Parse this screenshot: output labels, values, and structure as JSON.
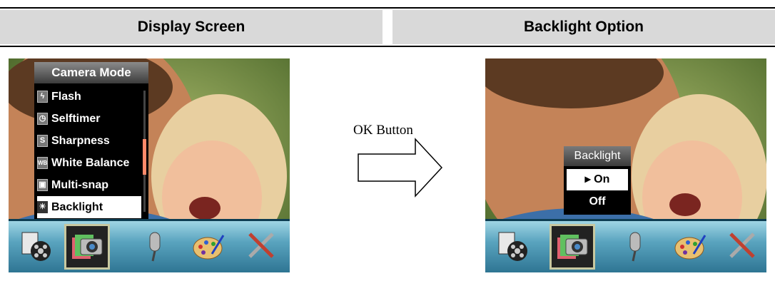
{
  "headers": {
    "left": "Display Screen",
    "right": "Backlight Option"
  },
  "left_screen": {
    "menu_title": "Camera Mode",
    "menu_items": [
      {
        "label": "Flash",
        "icon": "flash-icon",
        "glyph": "ϟ"
      },
      {
        "label": "Selftimer",
        "icon": "selftimer-icon",
        "glyph": "◷"
      },
      {
        "label": "Sharpness",
        "icon": "sharpness-icon",
        "glyph": "S"
      },
      {
        "label": "White Balance",
        "icon": "white-balance-icon",
        "glyph": "WB"
      },
      {
        "label": "Multi-snap",
        "icon": "multi-snap-icon",
        "glyph": "▣"
      },
      {
        "label": "Backlight",
        "icon": "backlight-icon",
        "glyph": "☀"
      }
    ],
    "selected_item": "Backlight"
  },
  "transition": {
    "label": "OK Button"
  },
  "right_screen": {
    "popup_title": "Backlight",
    "options": [
      "▸ On",
      "Off"
    ],
    "selected_option": "▸ On"
  },
  "icon_bar": [
    "movie-icon",
    "camera-icon",
    "microphone-icon",
    "palette-icon",
    "tools-icon"
  ],
  "colors": {
    "header_bg": "#d9d9d9",
    "icon_bar": "#5aa4bf",
    "menu_bg": "#000000",
    "highlight": "#ffffff",
    "scroll_thumb": "#ff8a6a"
  }
}
